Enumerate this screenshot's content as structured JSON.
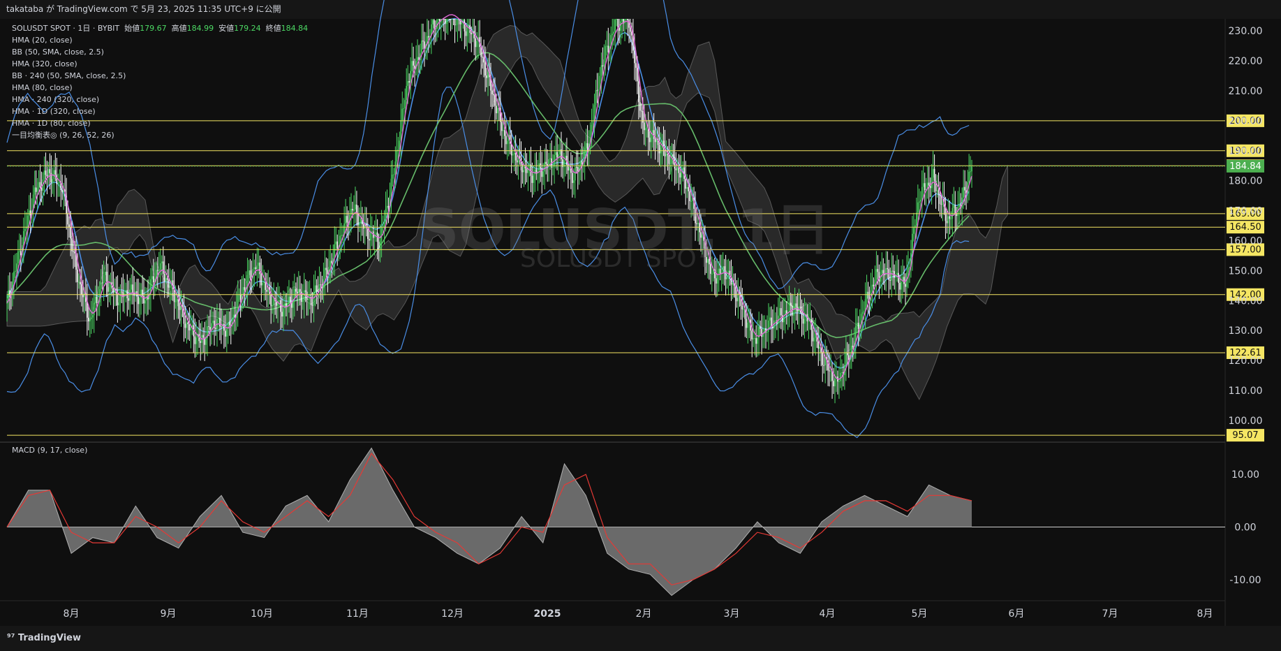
{
  "header": {
    "text": "takataba が TradingView.com で 5月 23, 2025 11:35 UTC+9 に公開"
  },
  "legend": {
    "symbol": "SOLUSDT SPOT · 1日 · BYBIT",
    "open_label": "始値",
    "open": "179.67",
    "high_label": "高値",
    "high": "184.99",
    "low_label": "安値",
    "low": "179.24",
    "close_label": "終値",
    "close": "184.84",
    "indicators": [
      "HMA (20, close)",
      "BB (50, SMA, close, 2.5)",
      "HMA (320, close)",
      "BB · 240 (50, SMA, close, 2.5)",
      "HMA (80, close)",
      "HMA · 240 (320, close)",
      "HMA · 1D (320, close)",
      "HMA · 1D (80, close)",
      "一目均衡表◎ (9, 26, 52, 26)"
    ]
  },
  "watermark": {
    "main": "SOLUSDT, 1日",
    "sub": "SOLUSDT SPOT"
  },
  "macd_label": "MACD (9, 17, close)",
  "brand": "TradingView",
  "colors": {
    "background": "#0f0f0f",
    "up": "#4cd964",
    "down": "#ffffff",
    "hma20": "#e06ad6",
    "bb": "#4a8ee6",
    "hma320": "#66bb6a",
    "level": "#f5e663",
    "price_tag": "#4caf50",
    "macd_signal": "#e53935",
    "macd_fill": "#7a7a7a"
  },
  "chart_data": [
    {
      "type": "line",
      "title": "SOLUSDT SPOT · 1日 · BYBIT",
      "ylim": [
        93,
        234
      ],
      "y_ticks": [
        100,
        110,
        120,
        130,
        140,
        150,
        160,
        170,
        180,
        190,
        200,
        210,
        220,
        230
      ],
      "x_ticks": [
        "8月",
        "9月",
        "10月",
        "11月",
        "12月",
        "2025",
        "2月",
        "3月",
        "4月",
        "5月",
        "6月",
        "7月",
        "8月"
      ],
      "last_price": 184.84,
      "horizontal_levels": [
        200.0,
        190.0,
        185.0,
        169.0,
        164.5,
        157.0,
        142.0,
        122.61,
        95.07
      ],
      "level_tags": [
        "200.00",
        "190.00",
        "185.00",
        "169.00",
        "164.50",
        "157.00",
        "142.00",
        "122.61",
        "95.07"
      ],
      "last_price_tag": "184.84",
      "series": [
        {
          "values": [
            [
              0,
              139
            ],
            [
              10,
              158
            ],
            [
              20,
              176
            ],
            [
              30,
              183
            ],
            [
              40,
              178
            ],
            [
              50,
              150
            ],
            [
              60,
              133
            ],
            [
              70,
              148
            ],
            [
              80,
              141
            ],
            [
              90,
              143
            ],
            [
              100,
              140
            ],
            [
              110,
              152
            ],
            [
              120,
              143
            ],
            [
              130,
              132
            ],
            [
              140,
              126
            ],
            [
              150,
              133
            ],
            [
              160,
              130
            ],
            [
              170,
              143
            ],
            [
              180,
              152
            ],
            [
              190,
              141
            ],
            [
              200,
              137
            ],
            [
              210,
              143
            ],
            [
              220,
              140
            ],
            [
              230,
              148
            ],
            [
              240,
              160
            ],
            [
              250,
              171
            ],
            [
              260,
              163
            ],
            [
              270,
              160
            ],
            [
              280,
              183
            ],
            [
              290,
              214
            ],
            [
              300,
              224
            ],
            [
              310,
              233
            ],
            [
              320,
              236
            ],
            [
              330,
              232
            ],
            [
              340,
              227
            ],
            [
              350,
              211
            ],
            [
              360,
              195
            ],
            [
              370,
              186
            ],
            [
              380,
              182
            ],
            [
              390,
              185
            ],
            [
              400,
              189
            ],
            [
              410,
              181
            ],
            [
              420,
              191
            ],
            [
              430,
              218
            ],
            [
              440,
              232
            ],
            [
              450,
              234
            ],
            [
              460,
              198
            ],
            [
              470,
              193
            ],
            [
              480,
              187
            ],
            [
              490,
              181
            ],
            [
              500,
              165
            ],
            [
              510,
              148
            ],
            [
              520,
              150
            ],
            [
              530,
              140
            ],
            [
              540,
              127
            ],
            [
              550,
              131
            ],
            [
              560,
              135
            ],
            [
              570,
              138
            ],
            [
              580,
              133
            ],
            [
              590,
              121
            ],
            [
              600,
              112
            ],
            [
              610,
              123
            ],
            [
              620,
              138
            ],
            [
              630,
              149
            ],
            [
              640,
              149
            ],
            [
              650,
              145
            ],
            [
              660,
              175
            ],
            [
              670,
              181
            ],
            [
              680,
              167
            ],
            [
              690,
              172
            ],
            [
              698,
              185
            ]
          ]
        }
      ]
    },
    {
      "type": "area",
      "title": "MACD (9, 17, close)",
      "ylim": [
        -14,
        16
      ],
      "y_ticks": [
        10.0,
        0.0,
        -10.0
      ],
      "series": [
        {
          "values": [
            [
              0,
              0
            ],
            [
              15,
              7
            ],
            [
              30,
              7
            ],
            [
              45,
              -5
            ],
            [
              60,
              -2
            ],
            [
              75,
              -3
            ],
            [
              90,
              4
            ],
            [
              105,
              -2
            ],
            [
              120,
              -4
            ],
            [
              135,
              2
            ],
            [
              150,
              6
            ],
            [
              165,
              -1
            ],
            [
              180,
              -2
            ],
            [
              195,
              4
            ],
            [
              210,
              6
            ],
            [
              225,
              1
            ],
            [
              240,
              9
            ],
            [
              255,
              15
            ],
            [
              270,
              7
            ],
            [
              285,
              0
            ],
            [
              300,
              -2
            ],
            [
              315,
              -5
            ],
            [
              330,
              -7
            ],
            [
              345,
              -4
            ],
            [
              360,
              2
            ],
            [
              375,
              -3
            ],
            [
              390,
              12
            ],
            [
              405,
              6
            ],
            [
              420,
              -5
            ],
            [
              435,
              -8
            ],
            [
              450,
              -9
            ],
            [
              465,
              -13
            ],
            [
              480,
              -10
            ],
            [
              495,
              -8
            ],
            [
              510,
              -4
            ],
            [
              525,
              1
            ],
            [
              540,
              -3
            ],
            [
              555,
              -5
            ],
            [
              570,
              1
            ],
            [
              585,
              4
            ],
            [
              600,
              6
            ],
            [
              615,
              4
            ],
            [
              630,
              2
            ],
            [
              645,
              8
            ],
            [
              660,
              6
            ],
            [
              675,
              5
            ]
          ]
        },
        {
          "values": [
            [
              0,
              0
            ],
            [
              15,
              6
            ],
            [
              30,
              7
            ],
            [
              45,
              -1
            ],
            [
              60,
              -3
            ],
            [
              75,
              -3
            ],
            [
              90,
              2
            ],
            [
              105,
              0
            ],
            [
              120,
              -3
            ],
            [
              135,
              0
            ],
            [
              150,
              5
            ],
            [
              165,
              1
            ],
            [
              180,
              -1
            ],
            [
              195,
              2
            ],
            [
              210,
              5
            ],
            [
              225,
              2
            ],
            [
              240,
              6
            ],
            [
              255,
              14
            ],
            [
              270,
              9
            ],
            [
              285,
              2
            ],
            [
              300,
              -1
            ],
            [
              315,
              -3
            ],
            [
              330,
              -7
            ],
            [
              345,
              -5
            ],
            [
              360,
              0
            ],
            [
              375,
              -1
            ],
            [
              390,
              8
            ],
            [
              405,
              10
            ],
            [
              420,
              -2
            ],
            [
              435,
              -7
            ],
            [
              450,
              -7
            ],
            [
              465,
              -11
            ],
            [
              480,
              -10
            ],
            [
              495,
              -8
            ],
            [
              510,
              -5
            ],
            [
              525,
              -1
            ],
            [
              540,
              -2
            ],
            [
              555,
              -4
            ],
            [
              570,
              -1
            ],
            [
              585,
              3
            ],
            [
              600,
              5
            ],
            [
              615,
              5
            ],
            [
              630,
              3
            ],
            [
              645,
              6
            ],
            [
              660,
              6
            ],
            [
              675,
              5
            ]
          ]
        }
      ]
    }
  ]
}
